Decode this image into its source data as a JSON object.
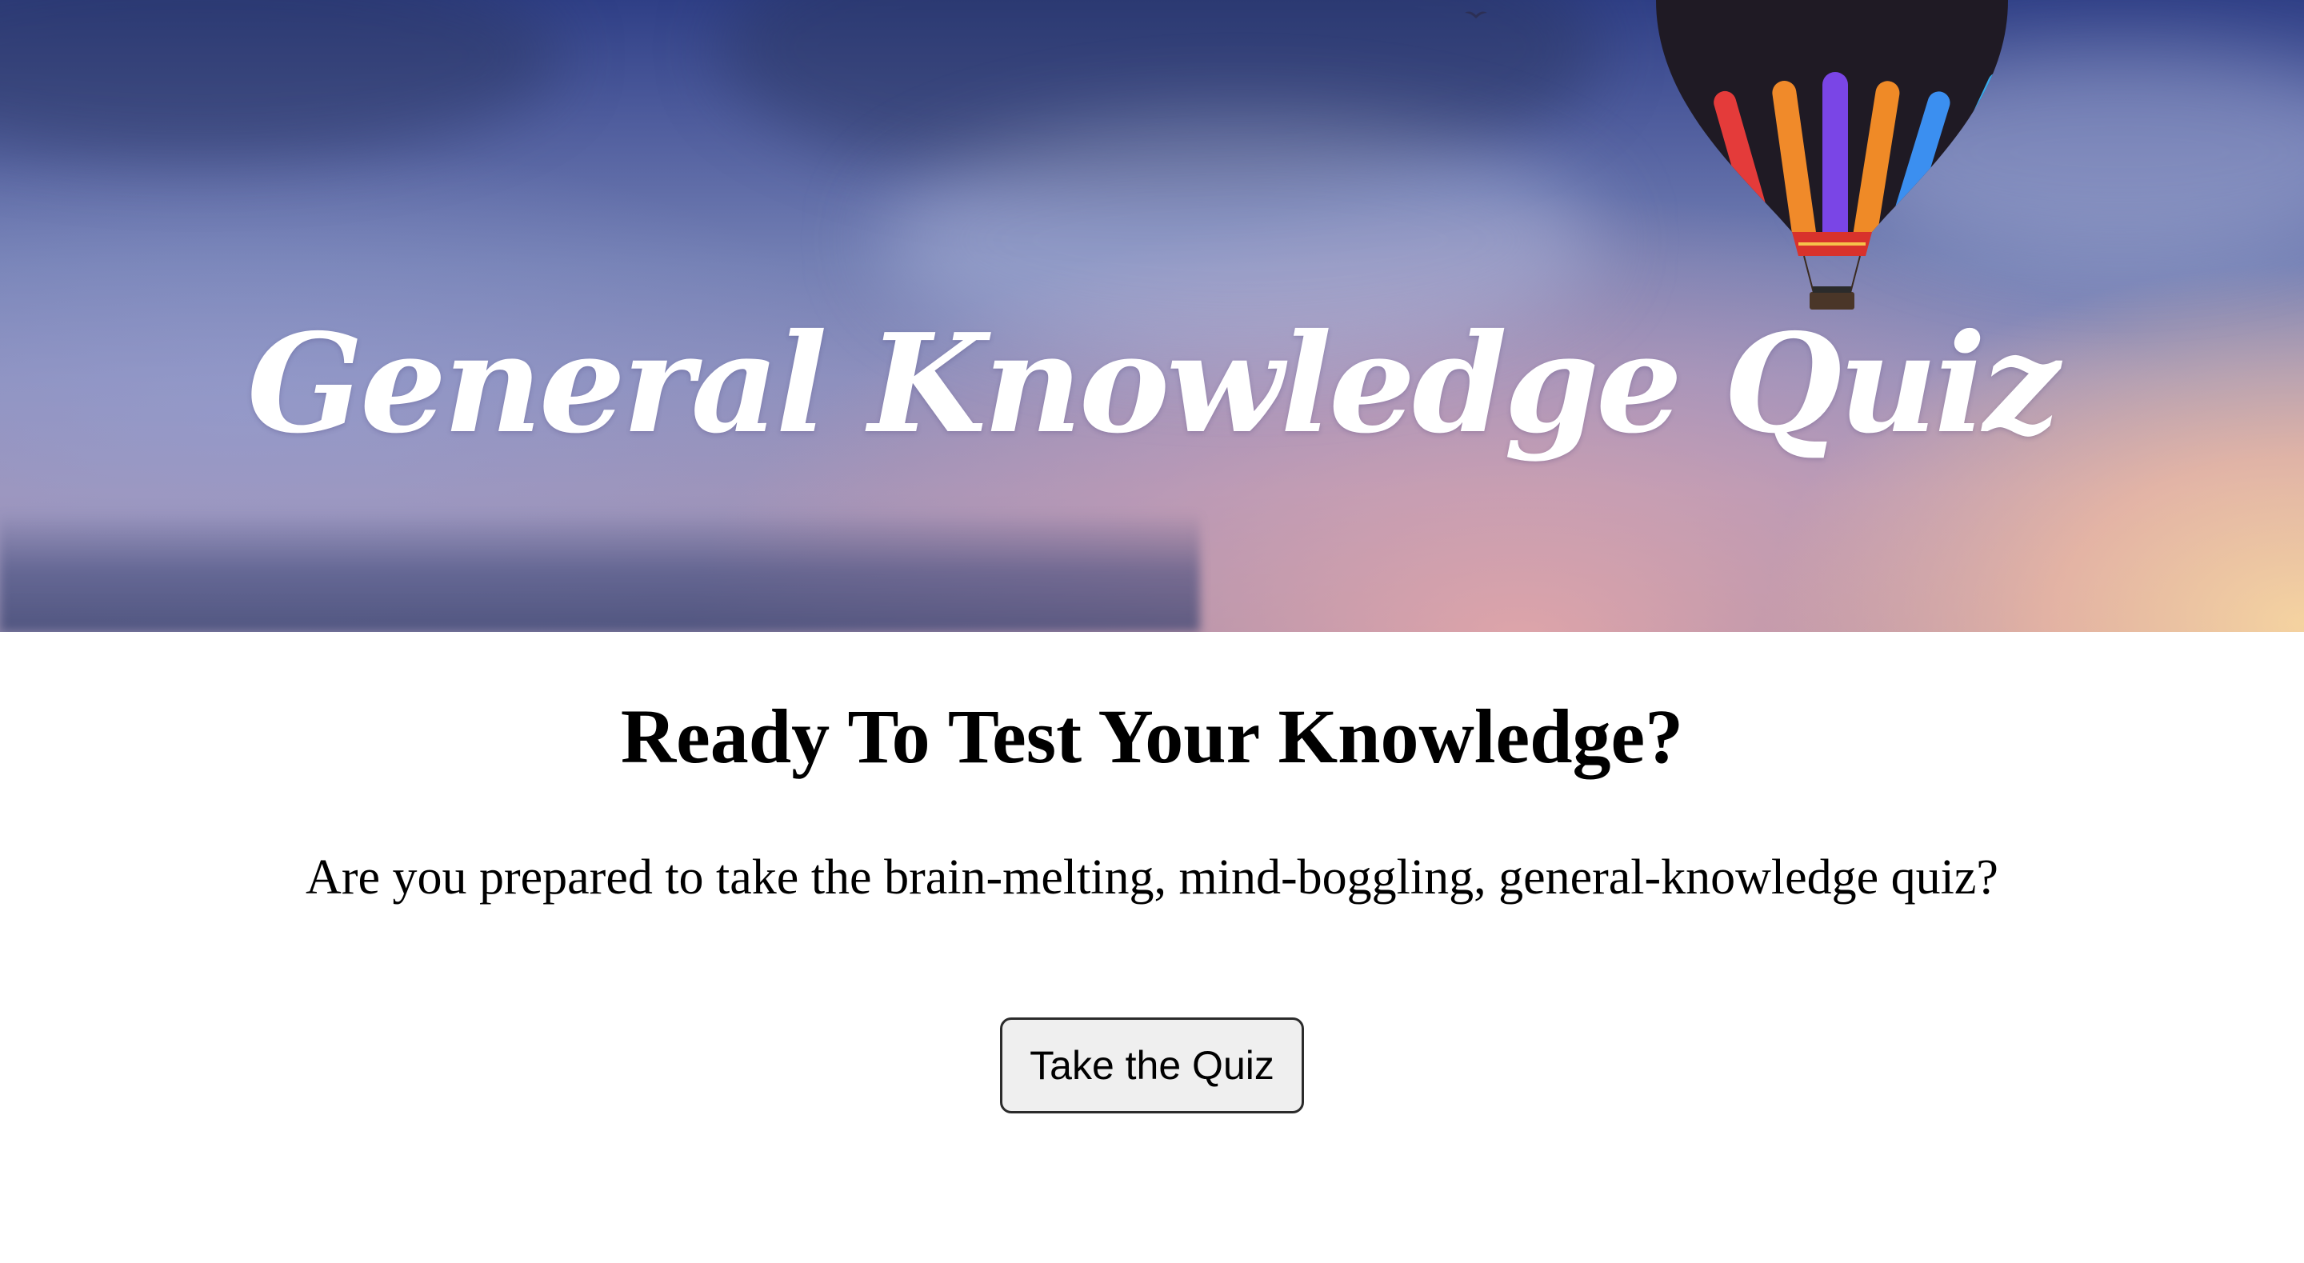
{
  "hero": {
    "title": "General Knowledge Quiz",
    "image_icon": "hot-air-balloon-icon",
    "colors": {
      "sky_top": "#2f3f86",
      "sky_mid": "#8d8fbd",
      "sunset_glow": "#f7d9a6",
      "title_text": "#ffffff"
    }
  },
  "main": {
    "heading": "Ready To Test Your Knowledge?",
    "description": "Are you prepared to take the brain-melting, mind-boggling, general-knowledge quiz?",
    "cta_label": "Take the Quiz"
  }
}
